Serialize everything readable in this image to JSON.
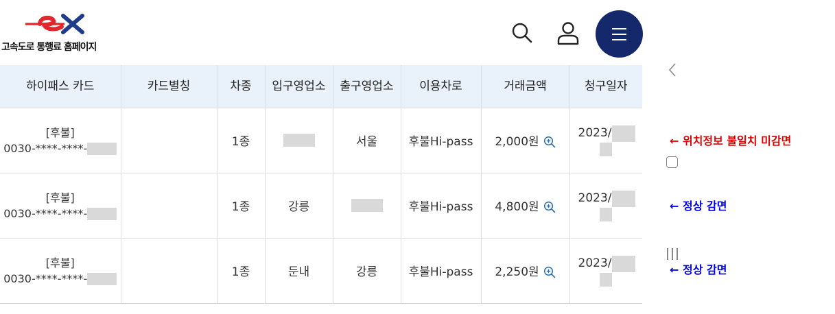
{
  "header": {
    "logo_text": "고속도로 통행료 홈페이지",
    "brand_color": "#14286b"
  },
  "table": {
    "columns": [
      "하이패스 카드",
      "카드별칭",
      "차종",
      "입구영업소",
      "출구영업소",
      "이용차로",
      "거래금액",
      "청구일자"
    ],
    "rows": [
      {
        "card_type": "[후불]",
        "card_number": "0030-****-****-",
        "alias": "",
        "vehicle": "1종",
        "entry": "",
        "exit": "서울",
        "lane": "후불Hi-pass",
        "amount": "2,000원",
        "date": "2023/"
      },
      {
        "card_type": "[후불]",
        "card_number": "0030-****-****-",
        "alias": "",
        "vehicle": "1종",
        "entry": "강릉",
        "exit": "",
        "lane": "후불Hi-pass",
        "amount": "4,800원",
        "date": "2023/"
      },
      {
        "card_type": "[후불]",
        "card_number": "0030-****-****-",
        "alias": "",
        "vehicle": "1종",
        "entry": "둔내",
        "exit": "강릉",
        "lane": "후불Hi-pass",
        "amount": "2,250원",
        "date": "2023/"
      }
    ]
  },
  "annotations": [
    {
      "text": "← 위치정보 불일치 미감면",
      "color": "#e00000"
    },
    {
      "text": "← 정상 감면",
      "color": "#0000e0"
    },
    {
      "text": "← 정상 감면",
      "color": "#0000e0"
    }
  ],
  "icons": [
    "search-icon",
    "user-icon",
    "menu-icon",
    "back-icon",
    "home-square-icon",
    "recent-apps-icon",
    "zoom-in-icon"
  ]
}
